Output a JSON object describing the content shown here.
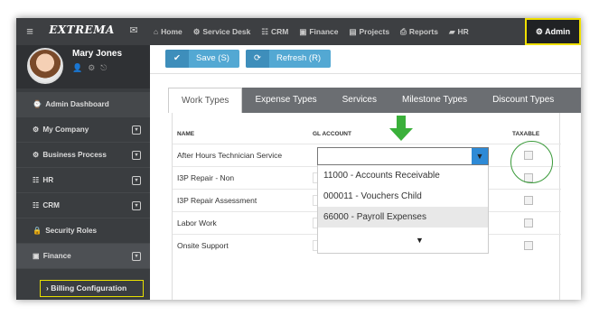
{
  "topbar": {
    "menu_icon": "hamburger-icon",
    "logo": "EXTREMA",
    "mail_icon": "mail-icon",
    "nav": [
      {
        "icon": "⌂",
        "label": "Home"
      },
      {
        "icon": "⚙",
        "label": "Service Desk"
      },
      {
        "icon": "☷",
        "label": "CRM"
      },
      {
        "icon": "▣",
        "label": "Finance"
      },
      {
        "icon": "▤",
        "label": "Projects"
      },
      {
        "icon": "⎙",
        "label": "Reports"
      },
      {
        "icon": "▰",
        "label": "HR"
      }
    ],
    "admin": {
      "icon": "⚙",
      "label": "Admin"
    }
  },
  "profile": {
    "name": "Mary Jones",
    "icons": "👤⚙⎋"
  },
  "sidebar": {
    "items": [
      {
        "icon": "⌚",
        "label": "Admin Dashboard"
      },
      {
        "icon": "⚙",
        "label": "My Company",
        "expand": "▾"
      },
      {
        "icon": "⚙",
        "label": "Business Process",
        "expand": "▾"
      },
      {
        "icon": "☷",
        "label": "HR",
        "expand": "▾"
      },
      {
        "icon": "☷",
        "label": "CRM",
        "expand": "▾"
      },
      {
        "icon": "🔒",
        "label": "Security Roles"
      },
      {
        "icon": "▣",
        "label": "Finance",
        "expand": "▾"
      }
    ],
    "sub_item": "›  Billing Configuration"
  },
  "toolbar": {
    "save": {
      "icon": "✔",
      "label": "Save (S)"
    },
    "refresh": {
      "icon": "⟳",
      "label": "Refresh (R)"
    }
  },
  "tabs": [
    "Work Types",
    "Expense Types",
    "Services",
    "Milestone Types",
    "Discount Types"
  ],
  "table": {
    "headers": {
      "name": "NAME",
      "gl": "GL ACCOUNT",
      "taxable": "TAXABLE"
    },
    "rows": [
      "After Hours Technician Service",
      "I3P Repair - Non",
      "I3P Repair Assessment",
      "Labor Work",
      "Onsite Support"
    ]
  },
  "gl_select": {
    "value": "",
    "arrow": "▼",
    "options": [
      "11000 - Accounts Receivable",
      "000011 - Vouchers Child",
      "66000 - Payroll Expenses"
    ],
    "more": "▼"
  },
  "colors": {
    "accent": "#53a8d3",
    "highlight": "#f0e000",
    "annotation": "#3ab03a"
  }
}
